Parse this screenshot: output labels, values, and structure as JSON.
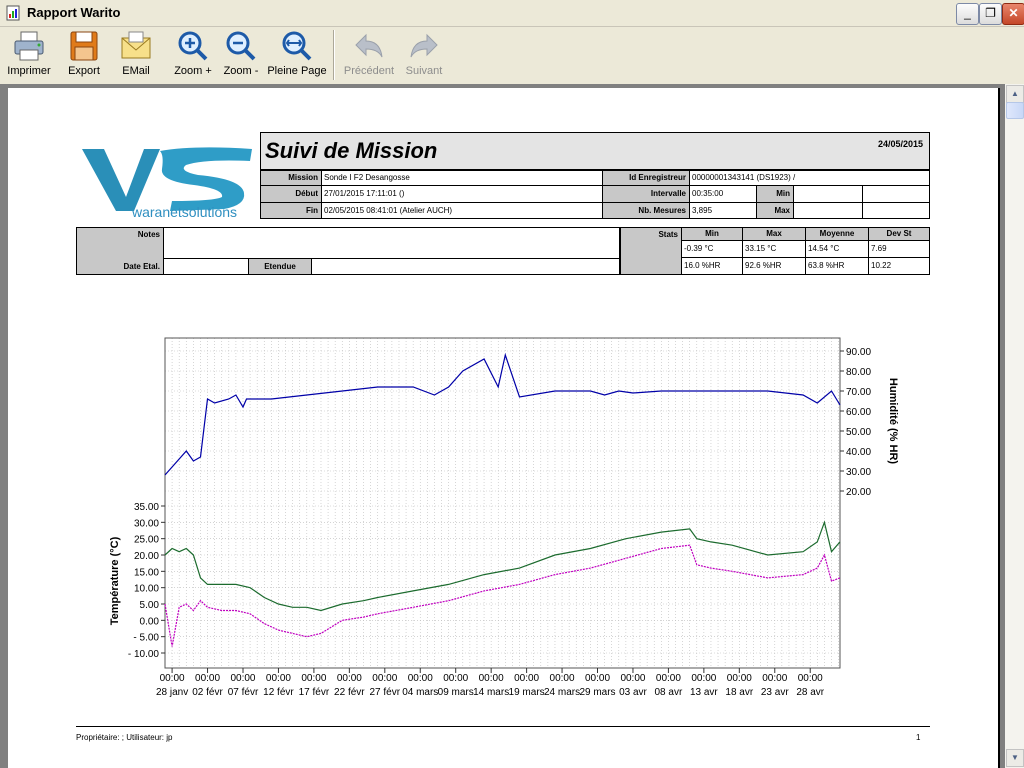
{
  "window": {
    "title": "Rapport Warito"
  },
  "toolbar": {
    "print": "Imprimer",
    "export": "Export",
    "email": "EMail",
    "zoom_in": "Zoom +",
    "zoom_out": "Zoom -",
    "full_page": "Pleine Page",
    "previous": "Précédent",
    "next": "Suivant"
  },
  "logo": {
    "text": "waranetsolutions"
  },
  "report": {
    "title": "Suivi de Mission",
    "date": "24/05/2015",
    "labels": {
      "mission": "Mission",
      "start": "Début",
      "end": "Fin",
      "recorder_id": "Id Enregistreur",
      "interval": "Intervalle",
      "count": "Nb. Mesures",
      "min": "Min",
      "max": "Max",
      "notes": "Notes",
      "calib_date": "Date Etal.",
      "range": "Etendue",
      "stats": "Stats"
    },
    "values": {
      "mission": "Sonde I F2 Desangosse",
      "start": "27/01/2015  17:11:01 ()",
      "end": "02/05/2015  08:41:01 (Atelier AUCH)",
      "recorder_id": "00000001343141 (DS1923) /",
      "interval": "00:35:00",
      "count": "3,895",
      "notes": "",
      "calib_date": "",
      "range": ""
    },
    "stats": {
      "headers": [
        "Min",
        "Max",
        "Moyenne",
        "Dev St"
      ],
      "rows": [
        [
          "-0.39 °C",
          "33.15 °C",
          "14.54 °C",
          "7.69"
        ],
        [
          "16.0 %HR",
          "92.6 %HR",
          "63.8 %HR",
          "10.22"
        ]
      ]
    },
    "footer": {
      "left": "Propriétaire: ;   Utilisateur: jp",
      "page": "1"
    }
  },
  "chart_data": {
    "type": "line",
    "y_left": {
      "label": "Température (°C)",
      "ticks": [
        "35.00",
        "30.00",
        "25.00",
        "20.00",
        "15.00",
        "10.00",
        "5.00",
        "0.00",
        "- 5.00",
        "- 10.00"
      ],
      "range": [
        -10,
        35
      ]
    },
    "y_right": {
      "label": "Humidité (% HR)",
      "ticks": [
        "90.00",
        "80.00",
        "70.00",
        "60.00",
        "50.00",
        "40.00",
        "30.00",
        "20.00"
      ],
      "range": [
        20,
        90
      ]
    },
    "x_ticks": [
      {
        "time": "00:00",
        "date": "28 janv"
      },
      {
        "time": "00:00",
        "date": "02 févr"
      },
      {
        "time": "00:00",
        "date": "07 févr"
      },
      {
        "time": "00:00",
        "date": "12 févr"
      },
      {
        "time": "00:00",
        "date": "17 févr"
      },
      {
        "time": "00:00",
        "date": "22 févr"
      },
      {
        "time": "00:00",
        "date": "27 févr"
      },
      {
        "time": "00:00",
        "date": "04 mars"
      },
      {
        "time": "00:00",
        "date": "09 mars"
      },
      {
        "time": "00:00",
        "date": "14 mars"
      },
      {
        "time": "00:00",
        "date": "19 mars"
      },
      {
        "time": "00:00",
        "date": "24 mars"
      },
      {
        "time": "00:00",
        "date": "29 mars"
      },
      {
        "time": "00:00",
        "date": "03 avr"
      },
      {
        "time": "00:00",
        "date": "08 avr"
      },
      {
        "time": "00:00",
        "date": "13 avr"
      },
      {
        "time": "00:00",
        "date": "18 avr"
      },
      {
        "time": "00:00",
        "date": "23 avr"
      },
      {
        "time": "00:00",
        "date": "28 avr"
      }
    ],
    "x_range": [
      "27/01/2015",
      "02/05/2015"
    ],
    "grid": true,
    "series": [
      {
        "axis": "right",
        "color": "#0000a8",
        "x": [
          0,
          3,
          4,
          5,
          6,
          7,
          9,
          10,
          11,
          11.5,
          12,
          15,
          20,
          25,
          30,
          35,
          38,
          40,
          42,
          45,
          47,
          48,
          50,
          55,
          60,
          62,
          64,
          66,
          70,
          75,
          80,
          85,
          90,
          92,
          94,
          95.2
        ],
        "y": [
          28,
          40,
          35,
          37,
          66,
          64,
          66,
          68,
          62,
          66,
          66,
          66,
          68,
          70,
          72,
          72,
          68,
          72,
          80,
          86,
          72,
          88,
          67,
          70,
          70,
          68,
          70,
          69,
          70,
          70,
          70,
          70,
          68,
          64,
          70,
          63
        ]
      },
      {
        "axis": "left",
        "color": "#1c6b2e",
        "x": [
          0,
          1,
          2,
          3,
          4,
          5,
          6,
          8,
          10,
          12,
          14,
          16,
          18,
          20,
          22,
          25,
          28,
          30,
          35,
          40,
          45,
          50,
          55,
          60,
          65,
          70,
          74,
          75,
          77,
          80,
          85,
          90,
          92,
          93,
          94,
          95.2
        ],
        "y": [
          20,
          22,
          21,
          22,
          20,
          13,
          11,
          11,
          11,
          10,
          7,
          5,
          4,
          4,
          3,
          5,
          6,
          7,
          9,
          11,
          14,
          16,
          20,
          22,
          25,
          27,
          28,
          25,
          24,
          23,
          20,
          21,
          24,
          30,
          21,
          24
        ]
      },
      {
        "axis": "left",
        "color": "#c000c0",
        "x": [
          0,
          1,
          2,
          3,
          4,
          5,
          6,
          8,
          10,
          12,
          14,
          16,
          18,
          20,
          22,
          25,
          28,
          30,
          35,
          40,
          45,
          50,
          55,
          60,
          65,
          70,
          74,
          75,
          77,
          80,
          85,
          90,
          92,
          93,
          94,
          95.2
        ],
        "y": [
          5,
          -8,
          4,
          5,
          3,
          6,
          4,
          3,
          3,
          2,
          -1,
          -3,
          -4,
          -5,
          -4,
          0,
          1,
          2,
          4,
          6,
          9,
          11,
          14,
          16,
          19,
          22,
          23,
          17,
          16,
          15,
          13,
          14,
          16,
          20,
          12,
          13
        ]
      }
    ]
  }
}
